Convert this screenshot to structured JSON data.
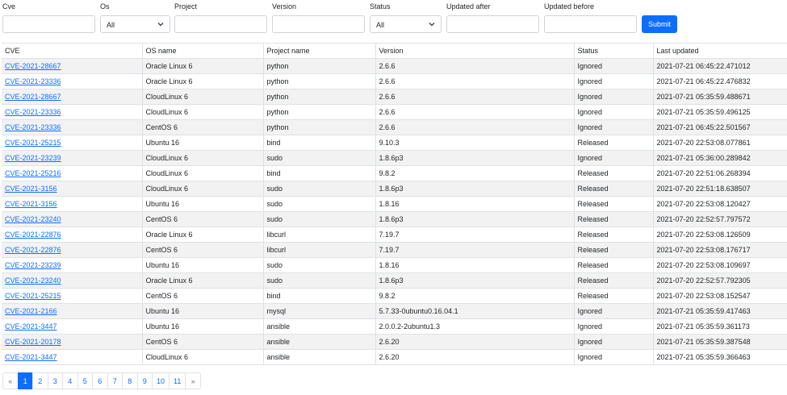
{
  "filters": {
    "cve": {
      "label": "Cve",
      "value": ""
    },
    "os": {
      "label": "Os",
      "selected": "All"
    },
    "project": {
      "label": "Project",
      "value": ""
    },
    "version": {
      "label": "Version",
      "value": ""
    },
    "status": {
      "label": "Status",
      "selected": "All"
    },
    "updated_after": {
      "label": "Updated after",
      "value": ""
    },
    "updated_before": {
      "label": "Updated before",
      "value": ""
    },
    "submit_label": "Submit"
  },
  "table": {
    "headers": [
      "CVE",
      "OS name",
      "Project name",
      "Version",
      "Status",
      "Last updated"
    ],
    "rows": [
      [
        "CVE-2021-28667",
        "Oracle Linux 6",
        "python",
        "2.6.6",
        "Ignored",
        "2021-07-21 06:45:22.471012"
      ],
      [
        "CVE-2021-23336",
        "Oracle Linux 6",
        "python",
        "2.6.6",
        "Ignored",
        "2021-07-21 06:45:22.476832"
      ],
      [
        "CVE-2021-28667",
        "CloudLinux 6",
        "python",
        "2.6.6",
        "Ignored",
        "2021-07-21 05:35:59.488671"
      ],
      [
        "CVE-2021-23336",
        "CloudLinux 6",
        "python",
        "2.6.6",
        "Ignored",
        "2021-07-21 05:35:59.496125"
      ],
      [
        "CVE-2021-23336",
        "CentOS 6",
        "python",
        "2.6.6",
        "Ignored",
        "2021-07-21 06:45:22.501567"
      ],
      [
        "CVE-2021-25215",
        "Ubuntu 16",
        "bind",
        "9.10.3",
        "Released",
        "2021-07-20 22:53:08.077861"
      ],
      [
        "CVE-2021-23239",
        "CloudLinux 6",
        "sudo",
        "1.8.6p3",
        "Ignored",
        "2021-07-21 05:36:00.289842"
      ],
      [
        "CVE-2021-25216",
        "CloudLinux 6",
        "bind",
        "9.8.2",
        "Released",
        "2021-07-20 22:51:06.268394"
      ],
      [
        "CVE-2021-3156",
        "CloudLinux 6",
        "sudo",
        "1.8.6p3",
        "Released",
        "2021-07-20 22:51:18.638507"
      ],
      [
        "CVE-2021-3156",
        "Ubuntu 16",
        "sudo",
        "1.8.16",
        "Released",
        "2021-07-20 22:53:08.120427"
      ],
      [
        "CVE-2021-23240",
        "CentOS 6",
        "sudo",
        "1.8.6p3",
        "Released",
        "2021-07-20 22:52:57.797572"
      ],
      [
        "CVE-2021-22876",
        "Oracle Linux 6",
        "libcurl",
        "7.19.7",
        "Released",
        "2021-07-20 22:53:08.126509"
      ],
      [
        "CVE-2021-22876",
        "CentOS 6",
        "libcurl",
        "7.19.7",
        "Released",
        "2021-07-20 22:53:08.176717"
      ],
      [
        "CVE-2021-23239",
        "Ubuntu 16",
        "sudo",
        "1.8.16",
        "Released",
        "2021-07-20 22:53:08.109697"
      ],
      [
        "CVE-2021-23240",
        "Oracle Linux 6",
        "sudo",
        "1.8.6p3",
        "Released",
        "2021-07-20 22:52:57.792305"
      ],
      [
        "CVE-2021-25215",
        "CentOS 6",
        "bind",
        "9.8.2",
        "Released",
        "2021-07-20 22:53:08.152547"
      ],
      [
        "CVE-2021-2166",
        "Ubuntu 16",
        "mysql",
        "5.7.33-0ubuntu0.16.04.1",
        "Ignored",
        "2021-07-21 05:35:59.417463"
      ],
      [
        "CVE-2021-3447",
        "Ubuntu 16",
        "ansible",
        "2.0.0.2-2ubuntu1.3",
        "Ignored",
        "2021-07-21 05:35:59.361173"
      ],
      [
        "CVE-2021-20178",
        "CentOS 6",
        "ansible",
        "2.6.20",
        "Ignored",
        "2021-07-21 05:35:59.387548"
      ],
      [
        "CVE-2021-3447",
        "CloudLinux 6",
        "ansible",
        "2.6.20",
        "Ignored",
        "2021-07-21 05:35:59.366463"
      ]
    ]
  },
  "pagination": {
    "prev": "«",
    "pages": [
      "1",
      "2",
      "3",
      "4",
      "5",
      "6",
      "7",
      "8",
      "9",
      "10",
      "11"
    ],
    "active": "1",
    "next": "»"
  },
  "colors": {
    "accent": "#0d6efd",
    "stripe": "#f2f2f2",
    "border": "#dee2e6"
  }
}
